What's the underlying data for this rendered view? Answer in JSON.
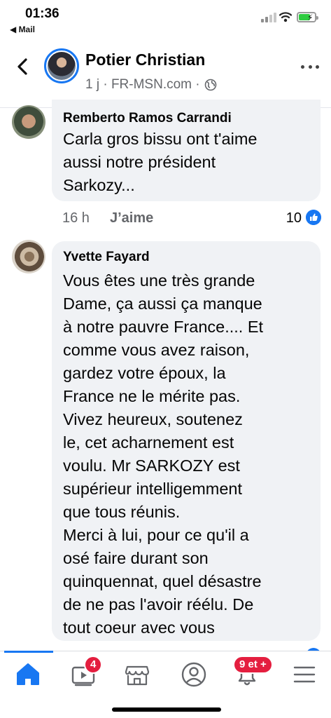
{
  "status_bar": {
    "time": "01:36",
    "back_app": "◀ Mail"
  },
  "header": {
    "name": "Potier Christian",
    "meta": "1 j · FR-MSN.com ·"
  },
  "comments": [
    {
      "author": "Remberto Ramos Carrandi",
      "text": "Carla gros bissu ont t'aime\naussi notre président\nSarkozy...",
      "time": "16 h",
      "like_label": "J’aime",
      "reaction_count": "10"
    },
    {
      "author": "Yvette Fayard",
      "text": "Vous êtes une très grande\nDame, ça aussi ça manque\nà notre pauvre France.... Et\ncomme vous avez raison,\ngardez votre époux,  la\nFrance ne le mérite pas.\nVivez heureux,  soutenez\nle, cet acharnement est\nvoulu. Mr SARKOZY est\nsupérieur intelligemment\nque tous réunis.\nMerci à lui, pour ce qu'il a\nosé faire durant son\nquinquennat, quel désastre\nde ne pas l'avoir réélu. De\ntout coeur avec vous"
    }
  ],
  "tabbar": {
    "video_badge": "4",
    "notifications_badge": "9 et +"
  },
  "colors": {
    "accent": "#1877f2",
    "badge": "#e41e3f",
    "bubble": "#f0f2f5"
  }
}
